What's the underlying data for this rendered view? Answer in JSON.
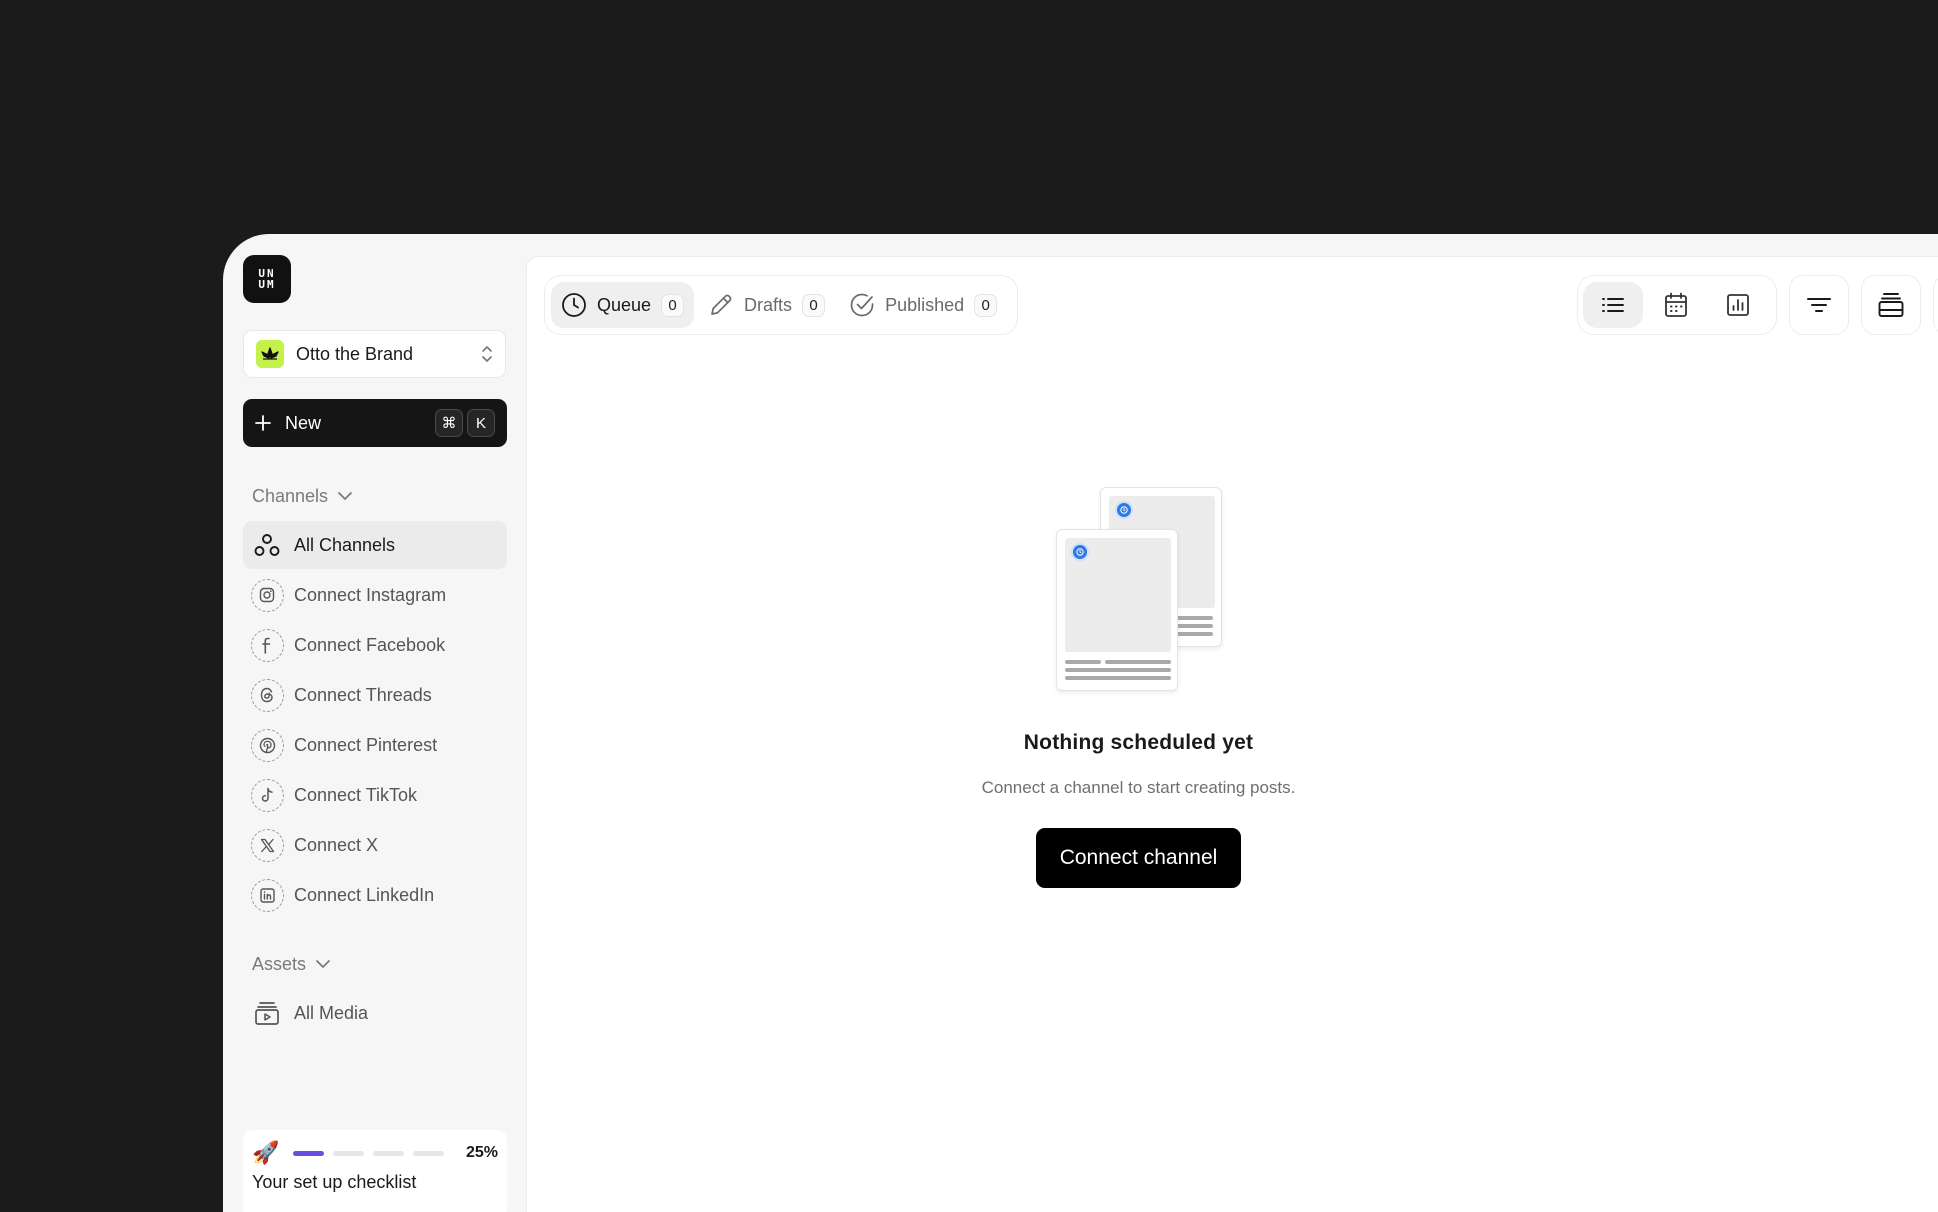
{
  "logo": {
    "text": "UN\nUM"
  },
  "brand": {
    "name": "Otto the Brand"
  },
  "new_button": {
    "label": "New",
    "shortcut_cmd": "⌘",
    "shortcut_key": "K"
  },
  "sidebar": {
    "channels_heading": "Channels",
    "channels": [
      {
        "label": "All Channels",
        "icon": "channels-icon",
        "active": true
      },
      {
        "label": "Connect Instagram",
        "icon": "instagram-icon"
      },
      {
        "label": "Connect Facebook",
        "icon": "facebook-icon"
      },
      {
        "label": "Connect Threads",
        "icon": "threads-icon"
      },
      {
        "label": "Connect Pinterest",
        "icon": "pinterest-icon"
      },
      {
        "label": "Connect TikTok",
        "icon": "tiktok-icon"
      },
      {
        "label": "Connect X",
        "icon": "x-icon"
      },
      {
        "label": "Connect LinkedIn",
        "icon": "linkedin-icon"
      }
    ],
    "assets_heading": "Assets",
    "assets": [
      {
        "label": "All Media",
        "icon": "media-icon"
      }
    ]
  },
  "checklist": {
    "percent_label": "25%",
    "progress_fraction": 0.25,
    "title": "Your set up checklist"
  },
  "tabs": [
    {
      "label": "Queue",
      "count": "0",
      "icon": "clock-icon",
      "active": true
    },
    {
      "label": "Drafts",
      "count": "0",
      "icon": "pencil-icon"
    },
    {
      "label": "Published",
      "count": "0",
      "icon": "check-circle-icon"
    }
  ],
  "view_modes": [
    "list-view-icon",
    "calendar-icon",
    "analytics-icon"
  ],
  "empty_state": {
    "title": "Nothing scheduled yet",
    "subtitle": "Connect a channel to start creating posts.",
    "button": "Connect channel"
  },
  "colors": {
    "accent": "#6b4de0",
    "brand_avatar": "#c5f24a",
    "schedule_dot": "#2f7be6",
    "dark": "#151515"
  }
}
